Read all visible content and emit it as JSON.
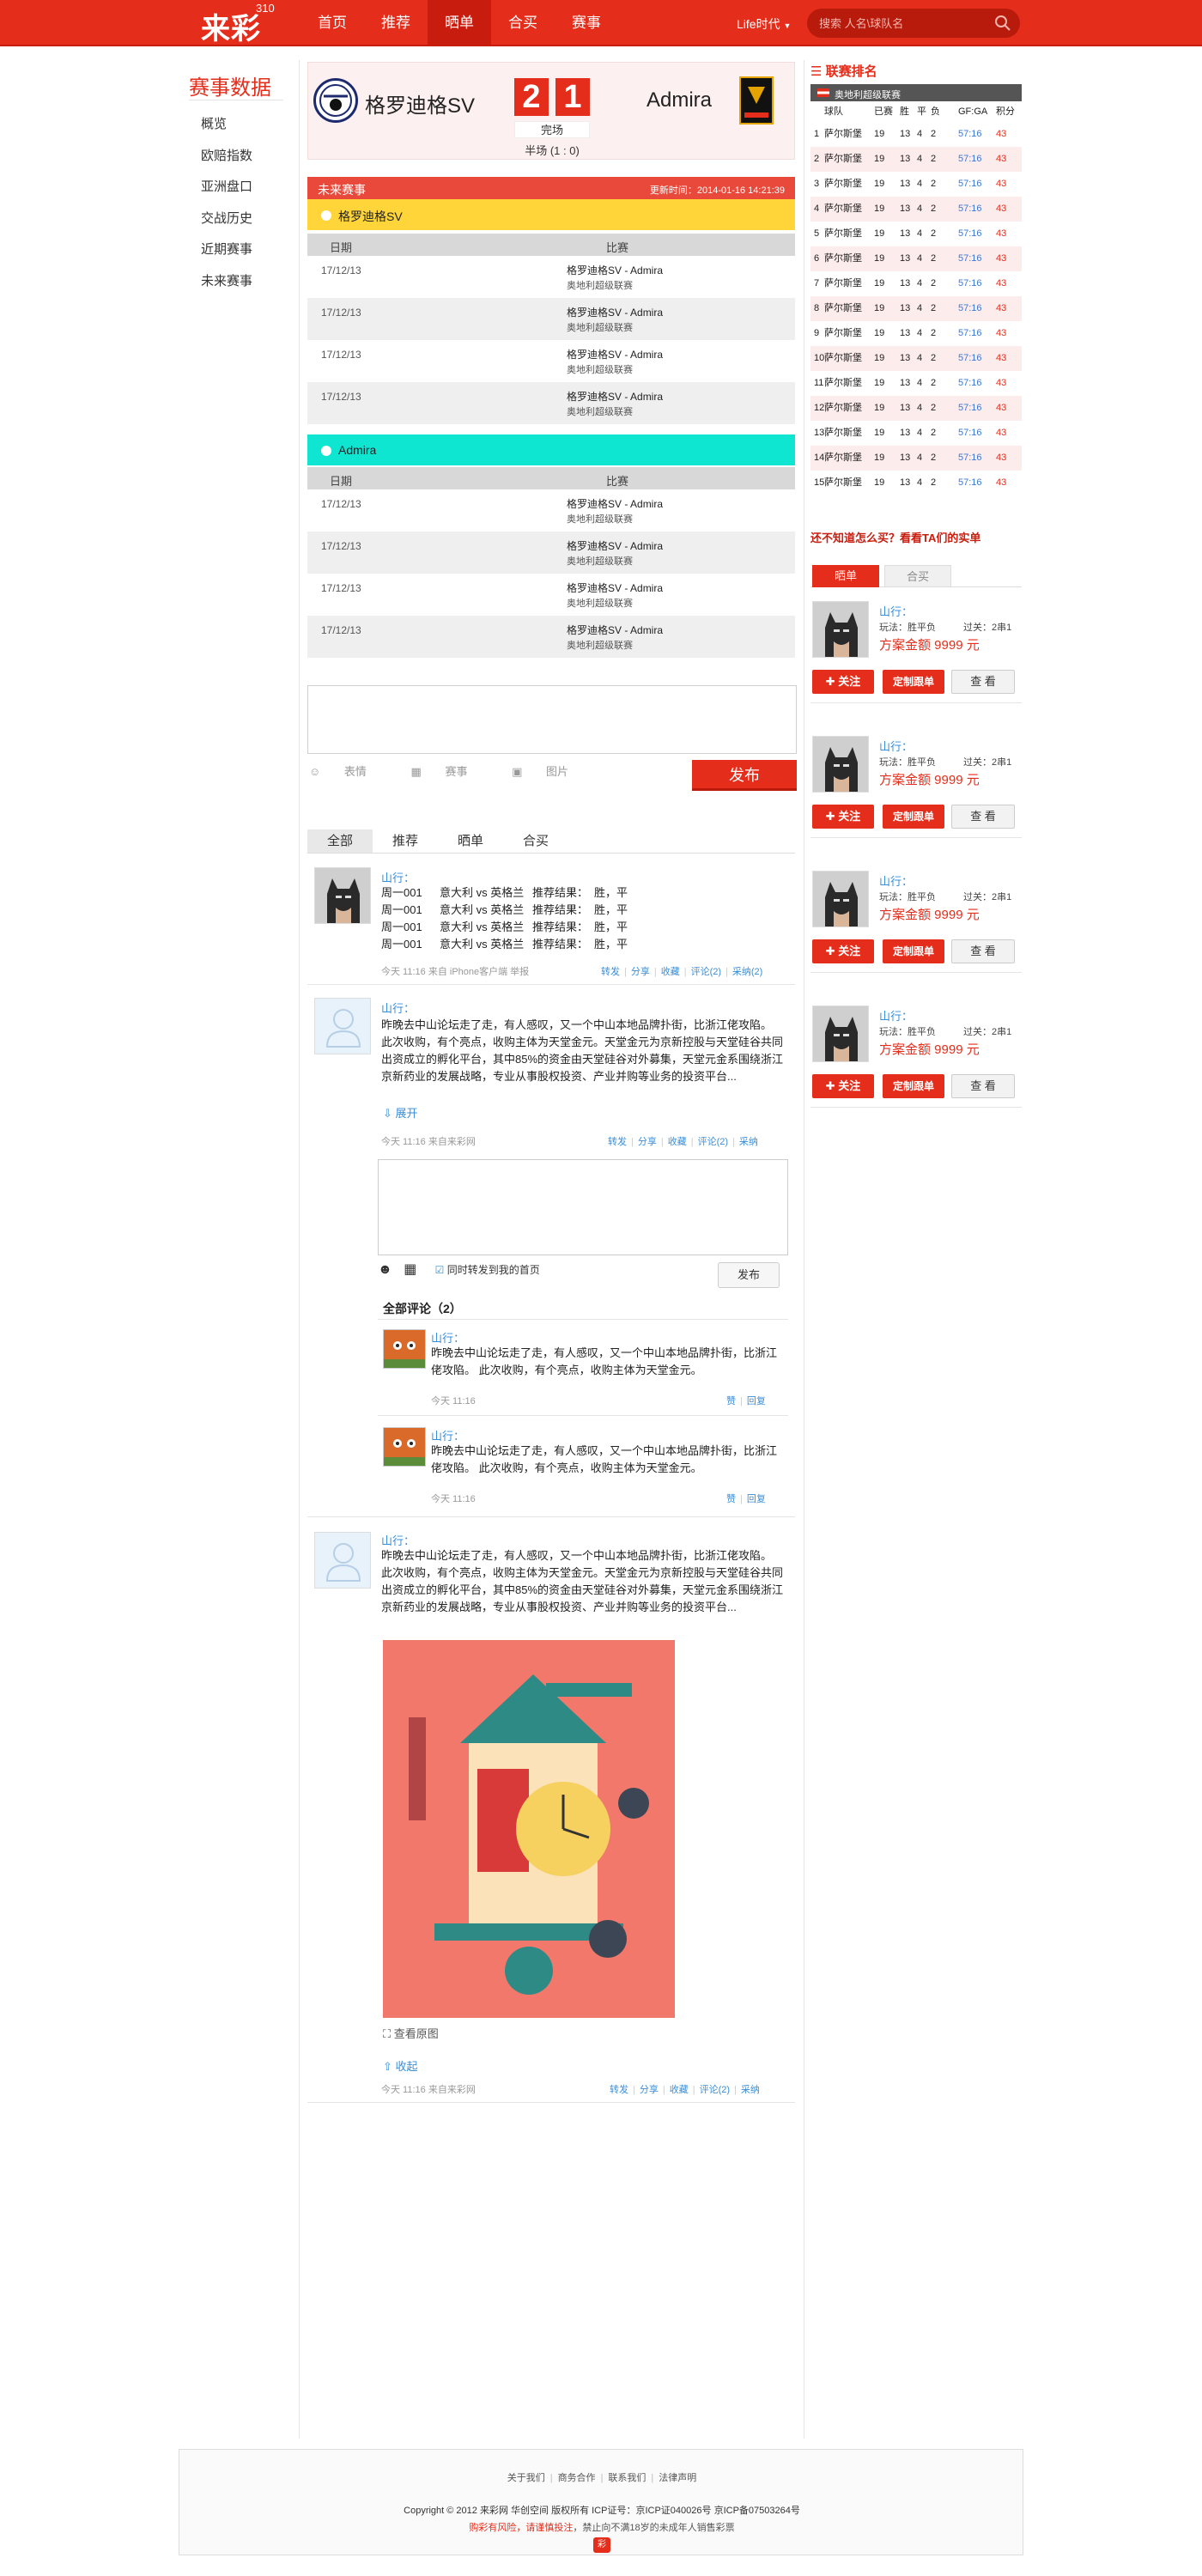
{
  "header": {
    "logo": "来彩",
    "logo_sup": "310",
    "nav": [
      "首页",
      "推荐",
      "晒单",
      "合买",
      "赛事"
    ],
    "active_nav": "晒单",
    "life": "Life时代",
    "search_placeholder": "搜索 人名\\球队名"
  },
  "sidebar": {
    "title": "赛事数据",
    "items": [
      "概览",
      "欧赔指数",
      "亚洲盘口",
      "交战历史",
      "近期赛事",
      "未来赛事"
    ]
  },
  "match": {
    "home": "格罗迪格SV",
    "away": "Admira",
    "home_score": "2",
    "away_score": "1",
    "status": "完场",
    "half": "半场 (1 : 0)"
  },
  "schedule": {
    "title": "未来赛事",
    "updated": "更新时间：2014-01-16  14:21:39",
    "col_date": "日期",
    "col_match": "比赛",
    "teams": [
      {
        "name": "格罗迪格SV",
        "color": "#ffd53a",
        "rows": [
          {
            "date": "17/12/13",
            "match": "格罗迪格SV - Admira",
            "league": "奥地利超级联赛"
          },
          {
            "date": "17/12/13",
            "match": "格罗迪格SV - Admira",
            "league": "奥地利超级联赛"
          },
          {
            "date": "17/12/13",
            "match": "格罗迪格SV - Admira",
            "league": "奥地利超级联赛"
          },
          {
            "date": "17/12/13",
            "match": "格罗迪格SV - Admira",
            "league": "奥地利超级联赛"
          }
        ]
      },
      {
        "name": "Admira",
        "color": "#0fe6d2",
        "rows": [
          {
            "date": "17/12/13",
            "match": "格罗迪格SV - Admira",
            "league": "奥地利超级联赛"
          },
          {
            "date": "17/12/13",
            "match": "格罗迪格SV - Admira",
            "league": "奥地利超级联赛"
          },
          {
            "date": "17/12/13",
            "match": "格罗迪格SV - Admira",
            "league": "奥地利超级联赛"
          },
          {
            "date": "17/12/13",
            "match": "格罗迪格SV - Admira",
            "league": "奥地利超级联赛"
          }
        ]
      }
    ]
  },
  "composer": {
    "tools": [
      "表情",
      "赛事",
      "图片"
    ],
    "post": "发布"
  },
  "feed": {
    "tabs": [
      "全部",
      "推荐",
      "晒单",
      "合买"
    ],
    "active_tab": "全部",
    "post1": {
      "user": "山行：",
      "lines": [
        [
          "周一001",
          "意大利 vs 英格兰",
          "推荐结果：",
          "胜，平"
        ],
        [
          "周一001",
          "意大利 vs 英格兰",
          "推荐结果：",
          "胜，平"
        ],
        [
          "周一001",
          "意大利 vs 英格兰",
          "推荐结果：",
          "胜，平"
        ],
        [
          "周一001",
          "意大利 vs 英格兰",
          "推荐结果：",
          "胜，平"
        ]
      ],
      "meta": "今天 11:16    来自 iPhone客户端    举报",
      "actions": [
        "转发",
        "分享",
        "收藏",
        "评论(2)",
        "采纳(2)"
      ]
    },
    "post2": {
      "user": "山行：",
      "text": "昨晚去中山论坛走了走，有人感叹，又一个中山本地品牌扑街，比浙江佬攻陷。 此次收购，有个亮点，收购主体为天堂金元。天堂金元为京新控股与天堂硅谷共同出资成立的孵化平台，其中85%的资金由天堂硅谷对外募集，天堂元金系围绕浙江京新药业的发展战略，专业从事股权投资、产业并购等业务的投资平台...",
      "expand": "展开",
      "meta": "今天 11:16    来自来彩网",
      "actions": [
        "转发",
        "分享",
        "收藏",
        "评论(2)",
        "采纳"
      ],
      "reply_also": "同时转发到我的首页",
      "reply_post": "发布",
      "comments_title": "全部评论（2）",
      "comments": [
        {
          "user": "山行：",
          "text": "昨晚去中山论坛走了走，有人感叹，又一个中山本地品牌扑街，比浙江佬攻陷。 此次收购，有个亮点，收购主体为天堂金元。",
          "time": "今天 11:16",
          "actions": [
            "赞",
            "回复"
          ]
        },
        {
          "user": "山行：",
          "text": "昨晚去中山论坛走了走，有人感叹，又一个中山本地品牌扑街，比浙江佬攻陷。 此次收购，有个亮点，收购主体为天堂金元。",
          "time": "今天 11:16",
          "actions": [
            "赞",
            "回复"
          ]
        }
      ]
    },
    "post3": {
      "user": "山行：",
      "text": "昨晚去中山论坛走了走，有人感叹，又一个中山本地品牌扑街，比浙江佬攻陷。 此次收购，有个亮点，收购主体为天堂金元。天堂金元为京新控股与天堂硅谷共同出资成立的孵化平台，其中85%的资金由天堂硅谷对外募集，天堂元金系围绕浙江京新药业的发展战略，专业从事股权投资、产业并购等业务的投资平台...",
      "view_original": "查看原图",
      "collapse": "收起",
      "meta": "今天 11:16    来自来彩网",
      "actions": [
        "转发",
        "分享",
        "收藏",
        "评论(2)",
        "采纳"
      ]
    }
  },
  "standings": {
    "title": "联赛排名",
    "league": "奥地利超级联赛",
    "headers": [
      "球队",
      "已赛",
      "胜",
      "平",
      "负",
      "GF:GA",
      "积分"
    ],
    "rows": [
      {
        "rank": "1",
        "team": "萨尔斯堡",
        "p": "19",
        "w": "13",
        "d": "4",
        "l": "2",
        "gfga": "57:16",
        "pts": "43"
      },
      {
        "rank": "2",
        "team": "萨尔斯堡",
        "p": "19",
        "w": "13",
        "d": "4",
        "l": "2",
        "gfga": "57:16",
        "pts": "43"
      },
      {
        "rank": "3",
        "team": "萨尔斯堡",
        "p": "19",
        "w": "13",
        "d": "4",
        "l": "2",
        "gfga": "57:16",
        "pts": "43"
      },
      {
        "rank": "4",
        "team": "萨尔斯堡",
        "p": "19",
        "w": "13",
        "d": "4",
        "l": "2",
        "gfga": "57:16",
        "pts": "43"
      },
      {
        "rank": "5",
        "team": "萨尔斯堡",
        "p": "19",
        "w": "13",
        "d": "4",
        "l": "2",
        "gfga": "57:16",
        "pts": "43"
      },
      {
        "rank": "6",
        "team": "萨尔斯堡",
        "p": "19",
        "w": "13",
        "d": "4",
        "l": "2",
        "gfga": "57:16",
        "pts": "43"
      },
      {
        "rank": "7",
        "team": "萨尔斯堡",
        "p": "19",
        "w": "13",
        "d": "4",
        "l": "2",
        "gfga": "57:16",
        "pts": "43"
      },
      {
        "rank": "8",
        "team": "萨尔斯堡",
        "p": "19",
        "w": "13",
        "d": "4",
        "l": "2",
        "gfga": "57:16",
        "pts": "43"
      },
      {
        "rank": "9",
        "team": "萨尔斯堡",
        "p": "19",
        "w": "13",
        "d": "4",
        "l": "2",
        "gfga": "57:16",
        "pts": "43"
      },
      {
        "rank": "10",
        "team": "萨尔斯堡",
        "p": "19",
        "w": "13",
        "d": "4",
        "l": "2",
        "gfga": "57:16",
        "pts": "43"
      },
      {
        "rank": "11",
        "team": "萨尔斯堡",
        "p": "19",
        "w": "13",
        "d": "4",
        "l": "2",
        "gfga": "57:16",
        "pts": "43"
      },
      {
        "rank": "12",
        "team": "萨尔斯堡",
        "p": "19",
        "w": "13",
        "d": "4",
        "l": "2",
        "gfga": "57:16",
        "pts": "43"
      },
      {
        "rank": "13",
        "team": "萨尔斯堡",
        "p": "19",
        "w": "13",
        "d": "4",
        "l": "2",
        "gfga": "57:16",
        "pts": "43"
      },
      {
        "rank": "14",
        "team": "萨尔斯堡",
        "p": "19",
        "w": "13",
        "d": "4",
        "l": "2",
        "gfga": "57:16",
        "pts": "43"
      },
      {
        "rank": "15",
        "team": "萨尔斯堡",
        "p": "19",
        "w": "13",
        "d": "4",
        "l": "2",
        "gfga": "57:16",
        "pts": "43"
      }
    ]
  },
  "right_bets": {
    "question": "还不知道怎么买？看看TA们的实单",
    "tabs": [
      "晒单",
      "合买"
    ],
    "cards": [
      {
        "user": "山行：",
        "play": "玩法：胜平负",
        "pass": "过关：2串1",
        "amount": "方案金额  9999 元",
        "follow": "关注",
        "custom": "定制跟单",
        "view": "查 看"
      },
      {
        "user": "山行：",
        "play": "玩法：胜平负",
        "pass": "过关：2串1",
        "amount": "方案金额  9999 元",
        "follow": "关注",
        "custom": "定制跟单",
        "view": "查 看"
      },
      {
        "user": "山行：",
        "play": "玩法：胜平负",
        "pass": "过关：2串1",
        "amount": "方案金额  9999 元",
        "follow": "关注",
        "custom": "定制跟单",
        "view": "查 看"
      },
      {
        "user": "山行：",
        "play": "玩法：胜平负",
        "pass": "过关：2串1",
        "amount": "方案金额  9999 元",
        "follow": "关注",
        "custom": "定制跟单",
        "view": "查 看"
      }
    ]
  },
  "footer": {
    "links": [
      "关于我们",
      "商务合作",
      "联系我们",
      "法律声明"
    ],
    "copyright": "Copyright © 2012  来彩网  华创空间  版权所有  ICP证号：京ICP证040026号  京ICP备07503264号",
    "warn_red": "购彩有风险，请谨慎投注",
    "warn_rest": "，禁止向不满18岁的未成年人销售彩票",
    "logo_mark": "彩"
  },
  "colors": {
    "brand": "#e52d1b",
    "link": "#3a8ed8"
  }
}
